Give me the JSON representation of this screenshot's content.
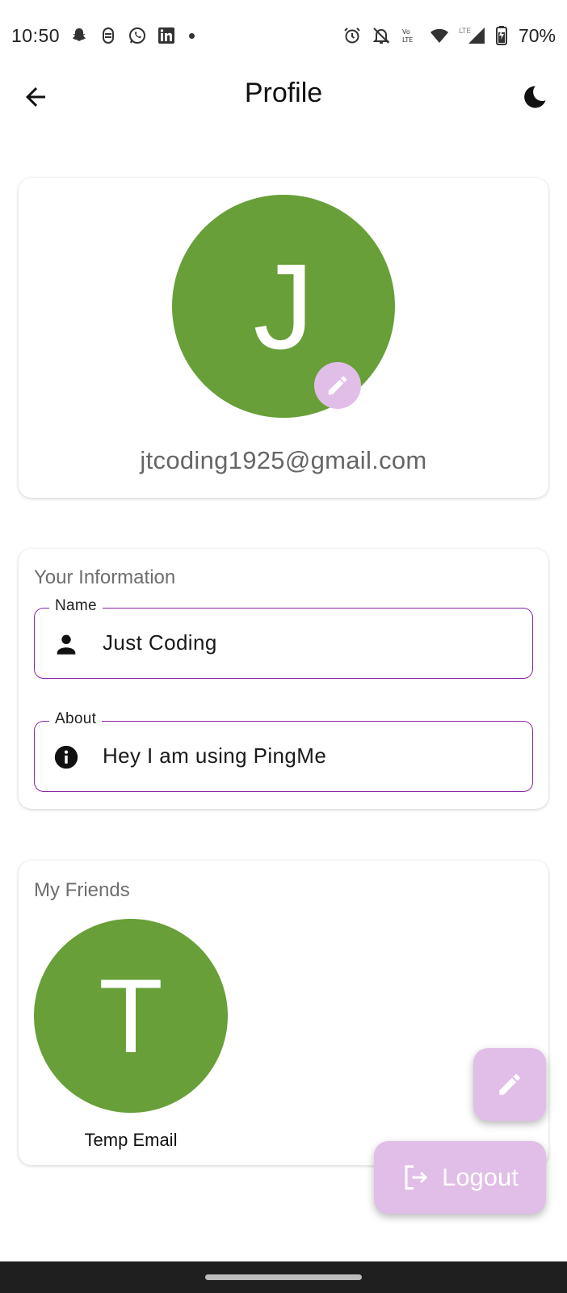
{
  "status_bar": {
    "time": "10:50",
    "battery": "70%",
    "network": "LTE",
    "icons_left": [
      "snapchat-icon",
      "messenger-icon",
      "whatsapp-icon",
      "linkedin-icon",
      "more-dot-icon"
    ],
    "icons_right": [
      "alarm-icon",
      "bell-off-icon",
      "volte-icon",
      "wifi-icon",
      "lte-signal-icon",
      "battery-icon"
    ]
  },
  "app_bar": {
    "title": "Profile",
    "back_icon": "arrow-back-icon",
    "theme_icon": "dark-mode-moon-icon"
  },
  "profile": {
    "avatar_initial": "J",
    "email": "jtcoding1925@gmail.com",
    "avatar_color": "#689f38",
    "edit_icon": "pencil-icon"
  },
  "info": {
    "section_title": "Your Information",
    "name_label": "Name",
    "name_value": "Just Coding",
    "about_label": "About",
    "about_value": "Hey I am using PingMe"
  },
  "friends": {
    "section_title": "My Friends",
    "items": [
      {
        "initial": "T",
        "name": "Temp Email"
      }
    ]
  },
  "actions": {
    "logout_label": "Logout",
    "accent_color": "#e1bee7",
    "field_border_color": "#8e24aa"
  }
}
